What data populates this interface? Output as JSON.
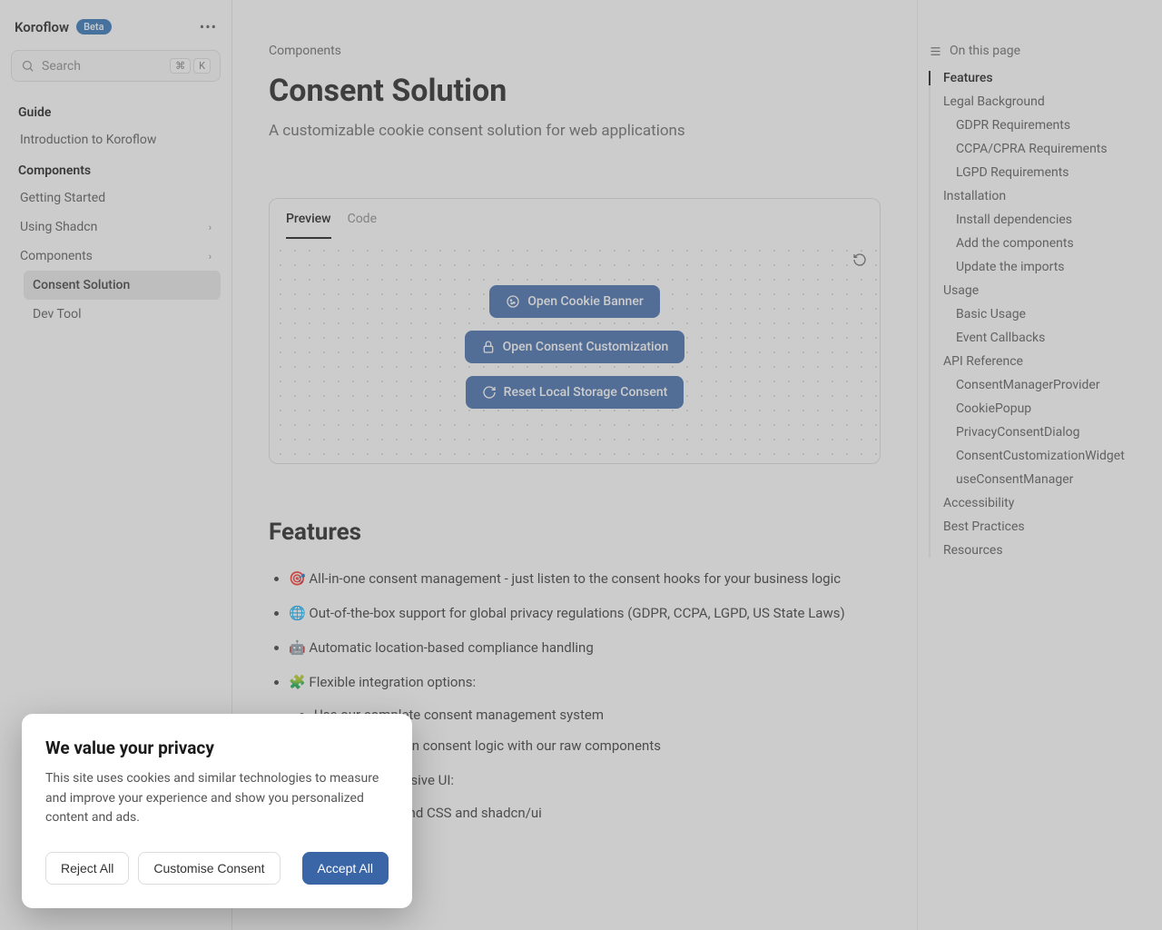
{
  "brand": {
    "name": "Koroflow",
    "badge": "Beta"
  },
  "search": {
    "placeholder": "Search",
    "kbd1": "⌘",
    "kbd2": "K"
  },
  "sidebar": {
    "sections": [
      {
        "title": "Guide",
        "items": [
          {
            "label": "Introduction to Koroflow"
          }
        ]
      },
      {
        "title": "Components",
        "items": [
          {
            "label": "Getting Started"
          },
          {
            "label": "Using Shadcn",
            "chevron": true
          },
          {
            "label": "Components",
            "chevron": true
          },
          {
            "label": "Consent Solution",
            "active": true,
            "indent": true
          },
          {
            "label": "Dev Tool",
            "indent": true
          }
        ]
      }
    ]
  },
  "breadcrumb": "Components",
  "title": "Consent Solution",
  "subtitle": "A customizable cookie consent solution for web applications",
  "card": {
    "tabs": [
      {
        "label": "Preview",
        "active": true
      },
      {
        "label": "Code"
      }
    ],
    "buttons": [
      {
        "label": "Open Cookie Banner",
        "icon": "cookie-icon"
      },
      {
        "label": "Open Consent Customization",
        "icon": "lock-icon"
      },
      {
        "label": "Reset Local Storage Consent",
        "icon": "refresh-icon"
      }
    ]
  },
  "features": {
    "heading": "Features",
    "items": [
      "🎯 All-in-one consent management - just listen to the consent hooks for your business logic",
      "🌐 Out-of-the-box support for global privacy regulations (GDPR, CCPA, LGPD, US State Laws)",
      "🤖 Automatic location-based compliance handling",
      "🧩 Flexible integration options:"
    ],
    "sub1": [
      "Use our complete consent management system",
      "Or build your own consent logic with our raw components"
    ],
    "item5": "🎨 Beautiful, responsive UI:",
    "sub2": [
      "Built with Tailwind CSS and shadcn/ui"
    ]
  },
  "toc": {
    "heading": "On this page",
    "items": [
      {
        "label": "Features",
        "active": true
      },
      {
        "label": "Legal Background"
      },
      {
        "label": "GDPR Requirements",
        "lvl": 2
      },
      {
        "label": "CCPA/CPRA Requirements",
        "lvl": 2
      },
      {
        "label": "LGPD Requirements",
        "lvl": 2
      },
      {
        "label": "Installation"
      },
      {
        "label": "Install dependencies",
        "lvl": 2
      },
      {
        "label": "Add the components",
        "lvl": 2
      },
      {
        "label": "Update the imports",
        "lvl": 2
      },
      {
        "label": "Usage"
      },
      {
        "label": "Basic Usage",
        "lvl": 2
      },
      {
        "label": "Event Callbacks",
        "lvl": 2
      },
      {
        "label": "API Reference"
      },
      {
        "label": "ConsentManagerProvider",
        "lvl": 2
      },
      {
        "label": "CookiePopup",
        "lvl": 2
      },
      {
        "label": "PrivacyConsentDialog",
        "lvl": 2
      },
      {
        "label": "ConsentCustomizationWidget",
        "lvl": 2
      },
      {
        "label": "useConsentManager",
        "lvl": 2
      },
      {
        "label": "Accessibility"
      },
      {
        "label": "Best Practices"
      },
      {
        "label": "Resources"
      }
    ]
  },
  "cookie": {
    "title": "We value your privacy",
    "body": "This site uses cookies and similar technologies to measure and improve your experience and show you personalized content and ads.",
    "reject": "Reject All",
    "customise": "Customise Consent",
    "accept": "Accept All"
  }
}
